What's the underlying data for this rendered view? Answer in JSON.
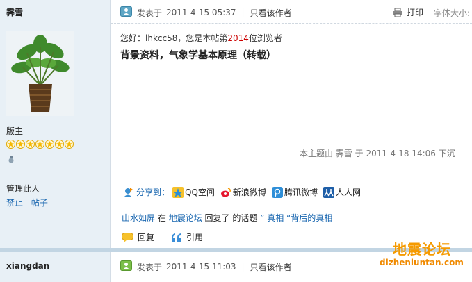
{
  "post1": {
    "author": "霁雪",
    "rank": "版主",
    "star_count": 7,
    "manage_label": "管理此人",
    "manage_links": [
      "禁止",
      "帖子"
    ],
    "posted_prefix": "发表于",
    "posted_time": "2011-4-15 05:37",
    "only_author": "只看该作者",
    "print_label": "打印",
    "font_size_label": "字体大小:",
    "greeting_prefix": "您好：lhkcc58，您是本帖第",
    "greeting_number": "2014",
    "greeting_suffix": "位浏览者",
    "title": "背景资料，气象学基本原理（转载）",
    "edited_note": "本主题由  霁雪  于  2011-4-18 14:06 下沉",
    "share_label": "分享到：",
    "share_targets": [
      "QQ空间",
      "新浪微博",
      "腾讯微博",
      "人人网"
    ],
    "reply_note": {
      "user": "山水如屏",
      "in": "在",
      "forum": "地震论坛",
      "replied": "回复了",
      "topic_prefix": "的话题",
      "topic": "” 真相 “背后的真相"
    },
    "actions": [
      "回复",
      "引用"
    ]
  },
  "post2": {
    "author": "xiangdan",
    "posted_prefix": "发表于",
    "posted_time": "2011-4-15 11:03",
    "only_author": "只看该作者"
  },
  "watermark": {
    "text": "地震论坛",
    "url": "dizhenluntan.com"
  },
  "colors": {
    "sidebar_bg": "#e8f0f6",
    "link": "#1a67b0",
    "highlight_number": "#cc0000",
    "watermark": "#f59a00"
  }
}
